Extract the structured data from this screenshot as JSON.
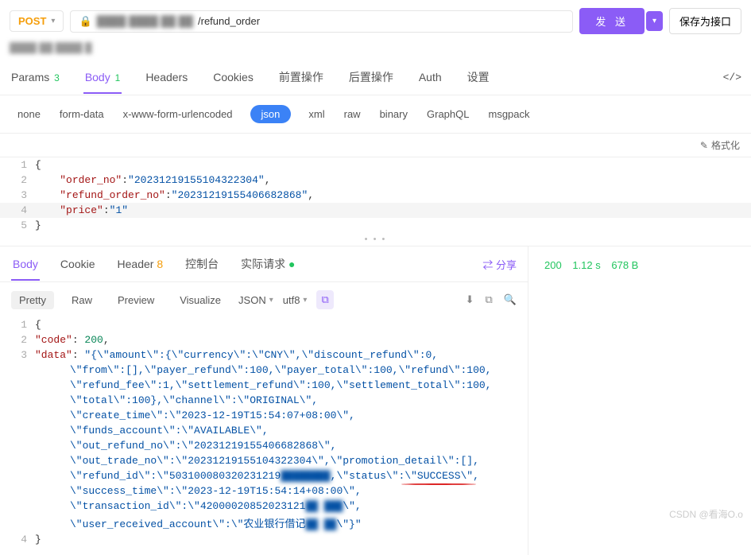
{
  "header": {
    "method": "POST",
    "url_hidden": "████ ████ ██ ██",
    "url_visible": "/refund_order",
    "send_button": "发 送",
    "save_button": "保存为接口",
    "info_hidden": "████ ██ ████ █"
  },
  "tabs": {
    "params": "Params",
    "params_count": "3",
    "body": "Body",
    "body_count": "1",
    "headers": "Headers",
    "cookies": "Cookies",
    "pre": "前置操作",
    "post": "后置操作",
    "auth": "Auth",
    "settings": "设置",
    "code_icon": "</>"
  },
  "body_types": {
    "none": "none",
    "form_data": "form-data",
    "x_www": "x-www-form-urlencoded",
    "json": "json",
    "xml": "xml",
    "raw": "raw",
    "binary": "binary",
    "graphql": "GraphQL",
    "msgpack": "msgpack"
  },
  "format_button": "格式化",
  "request_body": {
    "l1": "{",
    "l2_key": "\"order_no\"",
    "l2_val": "\"20231219155104322304\"",
    "l3_key": "\"refund_order_no\"",
    "l3_val": "\"20231219155406682868\"",
    "l4_key": "\"price\"",
    "l4_val": "\"1\"",
    "l5": "}"
  },
  "response": {
    "tabs": {
      "body": "Body",
      "cookie": "Cookie",
      "header": "Header",
      "header_count": "8",
      "console": "控制台",
      "actual": "实际请求",
      "share": "分享"
    },
    "toolbar": {
      "pretty": "Pretty",
      "raw": "Raw",
      "preview": "Preview",
      "visualize": "Visualize",
      "format": "JSON",
      "encoding": "utf8"
    },
    "status": {
      "code": "200",
      "time": "1.12 s",
      "size": "678 B"
    },
    "body": {
      "l1": "{",
      "l2_key": "\"code\"",
      "l2_val": "200",
      "l3_key": "\"data\"",
      "l3_start": "\"{\\\"amount\\\":{\\\"currency\\\":\\\"CNY\\\",\\\"discount_refund\\\":0,",
      "c1": "\\\"from\\\":[],\\\"payer_refund\\\":100,\\\"payer_total\\\":100,\\\"refund\\\":100,",
      "c2": "\\\"refund_fee\\\":1,\\\"settlement_refund\\\":100,\\\"settlement_total\\\":100,",
      "c3": "\\\"total\\\":100},\\\"channel\\\":\\\"ORIGINAL\\\",",
      "c4": "\\\"create_time\\\":\\\"2023-12-19T15:54:07+08:00\\\",",
      "c5": "\\\"funds_account\\\":\\\"AVAILABLE\\\",",
      "c6": "\\\"out_refund_no\\\":\\\"20231219155406682868\\\",",
      "c7": "\\\"out_trade_no\\\":\\\"20231219155104322304\\\",\\\"promotion_detail\\\":[],",
      "c8a": "\\\"refund_id\\\":\\\"503100080320231219",
      "c8_blur": "████████",
      "c8b": ",\\\"status\\\":",
      "c8_success": "\\\"SUCCESS\\\"",
      "c8c": ",",
      "c9": "\\\"success_time\\\":\\\"2023-12-19T15:54:14+08:00\\\",",
      "c10a": "\\\"transaction_id\\\":\\\"42000020852023121",
      "c10_blur": "██ ███",
      "c10b": "\\\",",
      "c11a": "\\\"user_received_account\\\":\\\"农业银行借记",
      "c11_blur": "██ ██",
      "c11b": "\\\"}\"",
      "l4": "}"
    }
  },
  "watermark": "CSDN @看海O.o",
  "chart_data": null
}
